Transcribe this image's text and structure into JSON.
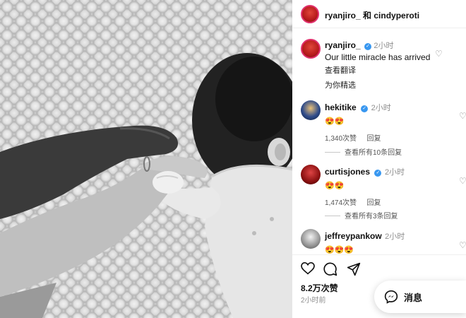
{
  "post": {
    "header_title": "ryanjiro_ 和 cindyperoti",
    "caption": {
      "username": "ryanjiro_",
      "time": "2小时",
      "text": "Our little miracle has arrived",
      "translate_label": "查看翻译"
    },
    "filter_label": "为你精选",
    "comments": [
      {
        "username": "hekitike",
        "time": "2小时",
        "verified": true,
        "text": "😍😍",
        "likes": "1,340次赞",
        "reply_label": "回复",
        "view_replies": "查看所有10条回复"
      },
      {
        "username": "curtisjones",
        "time": "2小时",
        "verified": true,
        "text": "😍😍",
        "likes": "1,474次赞",
        "reply_label": "回复",
        "view_replies": "查看所有3条回复"
      },
      {
        "username": "jeffreypankow",
        "time": "2小时",
        "verified": false,
        "text": "😍😍😍"
      }
    ],
    "like_count": "8.2万次赞",
    "posted_time": "2小时前",
    "message_label": "消息"
  },
  "colors": {
    "verified": "#3897f0",
    "muted": "#8e8e8e"
  },
  "icons": [
    "heart-icon",
    "comment-icon",
    "share-icon",
    "verified-icon",
    "messenger-icon"
  ]
}
